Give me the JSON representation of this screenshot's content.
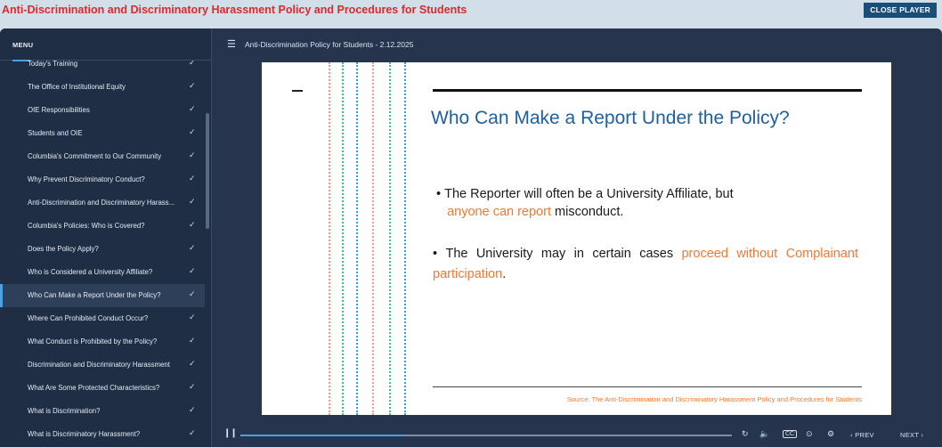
{
  "topbar": {
    "course_title": "Anti-Discrimination and Discriminatory Harassment Policy and Procedures for Students",
    "close_label": "CLOSE PLAYER"
  },
  "sidebar": {
    "menu_label": "MENU",
    "active_index": 10,
    "items": [
      {
        "label": "Today's Training"
      },
      {
        "label": "The Office of Institutional Equity"
      },
      {
        "label": "OIE Responsibilities"
      },
      {
        "label": "Students and OIE"
      },
      {
        "label": "Columbia's Commitment to Our Community"
      },
      {
        "label": "Why Prevent Discriminatory Conduct?"
      },
      {
        "label": "Anti-Discrimination and Discriminatory Harass..."
      },
      {
        "label": "Columbia's Policies: Who is Covered?"
      },
      {
        "label": "Does the Policy Apply?"
      },
      {
        "label": "Who is Considered a University Affiliate?"
      },
      {
        "label": "Who Can Make a Report Under the Policy?"
      },
      {
        "label": "Where Can Prohibited Conduct Occur?"
      },
      {
        "label": "What Conduct is Prohibited by the Policy?"
      },
      {
        "label": "Discrimination and Discriminatory Harassment"
      },
      {
        "label": "What Are Some Protected Characteristics?"
      },
      {
        "label": "What is Discrimination?"
      },
      {
        "label": "What is Discriminatory Harassment?"
      }
    ]
  },
  "main": {
    "lesson_title": "Anti-Discrimination Policy for Students - 2.12.2025"
  },
  "slide": {
    "title": "Who Can Make a Report Under the Policy?",
    "bullet1_a": "The Reporter  will often be a University Affiliate, but",
    "bullet1_orange": "anyone can report",
    "bullet1_b": " misconduct.",
    "bullet2_a": "The University may in certain cases ",
    "bullet2_orange": "proceed without Complainant participation",
    "bullet2_b": ".",
    "source": "Source: The Anti-Discrimination and Discriminatory Harassment Policy and Procedures for Students",
    "dotted_line_colors": [
      "#f2a07b",
      "#4cbf86",
      "#3d9ae0",
      "#f2a07b",
      "#4cbf86",
      "#3d9ae0"
    ]
  },
  "controls": {
    "progress": 0.33,
    "prev_label": "PREV",
    "next_label": "NEXT",
    "accent": "#4aa3df"
  }
}
